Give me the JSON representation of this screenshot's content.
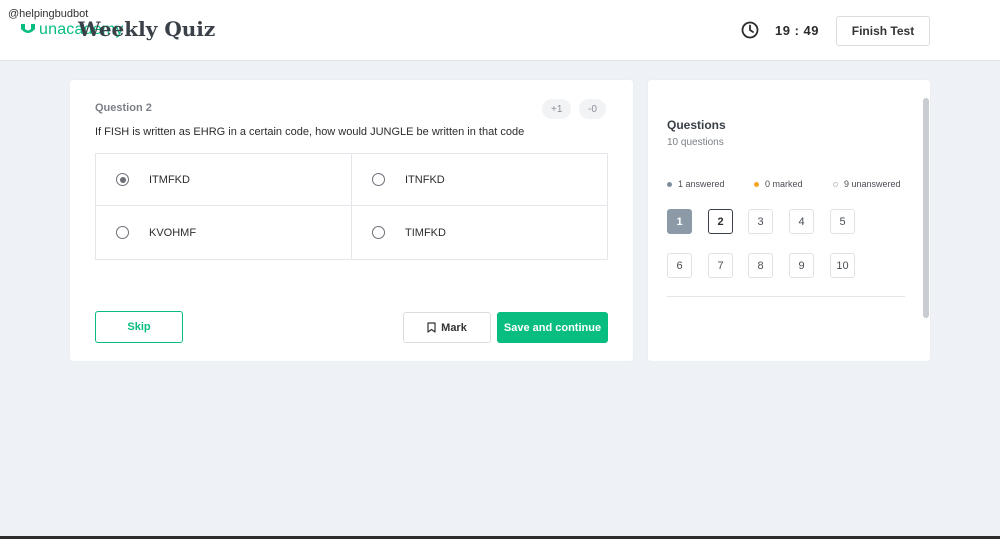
{
  "watermark": "@helpingbudbot",
  "header": {
    "logo_text": "unacademy",
    "title": "Weekly Quiz",
    "timer": "19 : 49",
    "finish_label": "Finish Test"
  },
  "question": {
    "number_label": "Question 2",
    "positive_mark": "+1",
    "negative_mark": "-0",
    "text": "If FISH is written as EHRG in a certain code, how would JUNGLE be written in that code",
    "options": [
      {
        "label": "ITMFKD",
        "selected": true
      },
      {
        "label": "ITNFKD",
        "selected": false
      },
      {
        "label": "KVOHMF",
        "selected": false
      },
      {
        "label": "TIMFKD",
        "selected": false
      }
    ],
    "skip_label": "Skip",
    "mark_label": "Mark",
    "save_label": "Save and continue"
  },
  "panel": {
    "title": "Questions",
    "subtitle": "10 questions",
    "legend": {
      "answered": "1 answered",
      "marked": "0 marked",
      "unanswered": "9 unanswered"
    },
    "questions": [
      "1",
      "2",
      "3",
      "4",
      "5",
      "6",
      "7",
      "8",
      "9",
      "10"
    ],
    "answered": [
      "1"
    ],
    "current": "2"
  },
  "colors": {
    "accent": "#08bd80",
    "answered": "#8c9aa8",
    "marked": "#f5a623"
  }
}
